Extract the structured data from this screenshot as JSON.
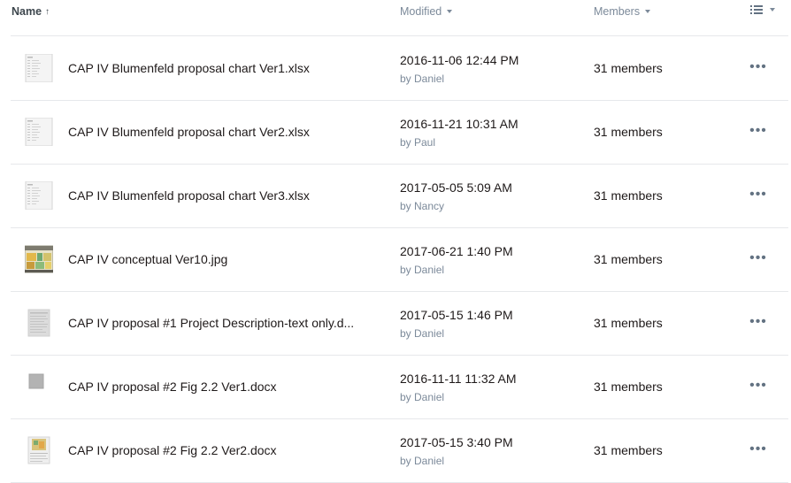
{
  "header": {
    "name_label": "Name",
    "modified_label": "Modified",
    "members_label": "Members"
  },
  "rows": [
    {
      "name": "CAP IV Blumenfeld proposal chart Ver1.xlsx",
      "date": "2016-11-06 12:44 PM",
      "by": "by Daniel",
      "members": "31 members",
      "thumb": "spreadsheet"
    },
    {
      "name": "CAP IV Blumenfeld proposal chart Ver2.xlsx",
      "date": "2016-11-21 10:31 AM",
      "by": "by Paul",
      "members": "31 members",
      "thumb": "spreadsheet"
    },
    {
      "name": "CAP IV Blumenfeld proposal chart Ver3.xlsx",
      "date": "2017-05-05 5:09 AM",
      "by": "by Nancy",
      "members": "31 members",
      "thumb": "spreadsheet"
    },
    {
      "name": "CAP IV conceptual Ver10.jpg",
      "date": "2017-06-21 1:40 PM",
      "by": "by Daniel",
      "members": "31 members",
      "thumb": "image"
    },
    {
      "name": "CAP IV proposal #1 Project Description-text only.d...",
      "date": "2017-05-15 1:46 PM",
      "by": "by Daniel",
      "members": "31 members",
      "thumb": "document"
    },
    {
      "name": "CAP IV proposal #2 Fig 2.2 Ver1.docx",
      "date": "2016-11-11 11:32 AM",
      "by": "by Daniel",
      "members": "31 members",
      "thumb": "gray"
    },
    {
      "name": "CAP IV proposal #2 Fig 2.2 Ver2.docx",
      "date": "2017-05-15 3:40 PM",
      "by": "by Daniel",
      "members": "31 members",
      "thumb": "docimage"
    }
  ]
}
